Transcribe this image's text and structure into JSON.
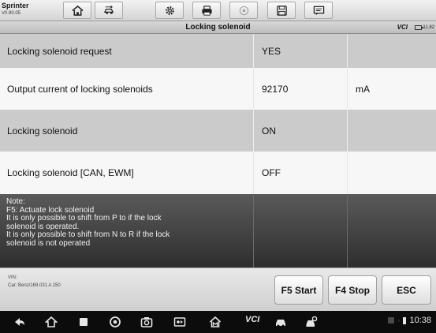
{
  "app": {
    "name": "Sprinter",
    "version": "V0.90.05"
  },
  "toolbar": {
    "buttons": [
      {
        "icon": "home-icon"
      },
      {
        "icon": "vehicle-swap-icon"
      },
      {
        "icon": "settings-icon"
      },
      {
        "icon": "print-icon"
      },
      {
        "icon": "help-icon",
        "disabled": true
      },
      {
        "icon": "save-icon"
      },
      {
        "icon": "message-icon"
      }
    ]
  },
  "header": {
    "title": "Locking solenoid",
    "vci": "VCI",
    "battery": "11.82"
  },
  "rows": [
    {
      "name": "Locking solenoid request",
      "value": "YES",
      "unit": ""
    },
    {
      "name": "Output current of locking solenoids",
      "value": "92170",
      "unit": "mA"
    },
    {
      "name": "Locking solenoid",
      "value": "ON",
      "unit": ""
    },
    {
      "name": "Locking solenoid [CAN, EWM]",
      "value": "OFF",
      "unit": ""
    }
  ],
  "note": {
    "lines": [
      "Note:",
      "F5: Actuate lock solenoid",
      "It is only possible to shift from P to if the lock",
      "solenoid is operated.",
      "It is only possible to shift from N to R if the lock",
      "solenoid is not operated"
    ]
  },
  "footer": {
    "vin_label": "VIN:",
    "car_label": "Car: Benz/169.031 A 150",
    "buttons": {
      "f5": "F5 Start",
      "f4": "F4 Stop",
      "esc": "ESC"
    }
  },
  "navbar": {
    "vci_label": "VCI",
    "time": "10:38"
  },
  "colors": {
    "row_shade": "#cbcbcb",
    "row_light": "#f7f7f7",
    "note_bg": "#3a3a3a",
    "nav_bg": "#0c0c0c"
  }
}
